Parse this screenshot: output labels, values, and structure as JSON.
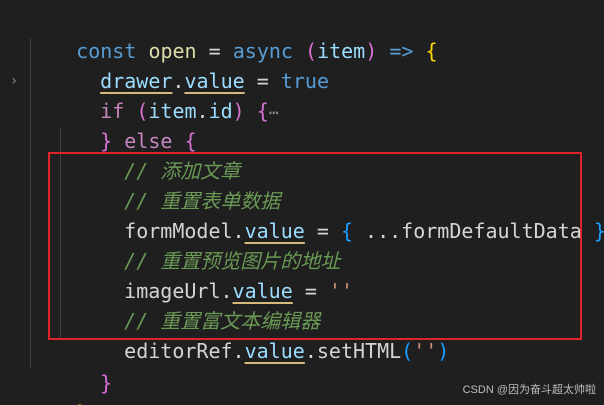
{
  "code": {
    "line1": {
      "const": "const",
      "name": "open",
      "eq": "=",
      "async": "async",
      "lparen": "(",
      "param": "item",
      "rparen": ")",
      "arrow": "=>",
      "brace": "{"
    },
    "line2": {
      "obj": "drawer",
      "dot": ".",
      "prop": "value",
      "eq": "=",
      "val": "true"
    },
    "line3": {
      "if": "if",
      "lparen": "(",
      "obj": "item",
      "dot": ".",
      "prop": "id",
      "rparen": ")",
      "brace": "{",
      "ellipsis": "⋯"
    },
    "line4": {
      "rbrace": "}",
      "else": "else",
      "brace": "{"
    },
    "line5": {
      "comment": "// 添加文章"
    },
    "line6": {
      "comment": "// 重置表单数据"
    },
    "line7": {
      "obj": "formModel",
      "dot": ".",
      "prop": "value",
      "eq": "=",
      "lbrace": "{",
      "spread": "...",
      "ident": "formDefaultData",
      "rbrace": "}"
    },
    "line8": {
      "comment": "// 重置预览图片的地址"
    },
    "line9": {
      "obj": "imageUrl",
      "dot": ".",
      "prop": "value",
      "eq": "=",
      "str": "''"
    },
    "line10": {
      "comment": "// 重置富文本编辑器"
    },
    "line11": {
      "obj": "editorRef",
      "dot": ".",
      "prop": "value",
      "dot2": ".",
      "method": "setHTML",
      "lparen": "(",
      "str": "''",
      "rparen": ")"
    },
    "line12": {
      "rbrace": "}"
    },
    "line13": {
      "rbrace": "}"
    }
  },
  "fold_icon": "chevron-right-icon",
  "fold_glyph": "›",
  "watermark": "CSDN @因为奋斗超太帅啦",
  "colors": {
    "background": "#1f1f1f",
    "highlight_border": "#e0242b"
  }
}
